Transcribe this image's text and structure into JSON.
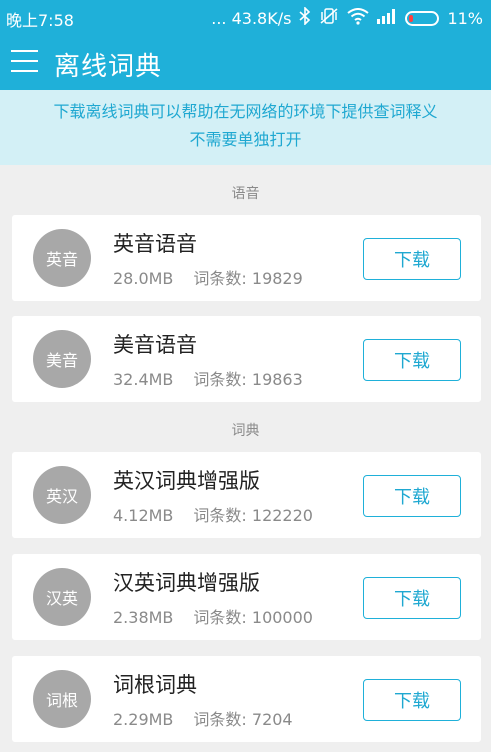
{
  "status": {
    "time": "晚上7:58",
    "network_speed": "... 43.8K/s",
    "battery_percent": "11%",
    "icons": [
      "bluetooth-icon",
      "vibrate-off-icon",
      "wifi-icon",
      "signal-icon",
      "battery-icon"
    ]
  },
  "appbar": {
    "title": "离线词典",
    "menu_icon": "menu-icon"
  },
  "notice": {
    "line1": "下载离线词典可以帮助在无网络的环境下提供查词释义",
    "line2": "不需要单独打开"
  },
  "sections": [
    {
      "label": "语音",
      "items": [
        {
          "badge": "英音",
          "name": "英音语音",
          "size": "28.0MB",
          "count": "词条数: 19829",
          "button": "下载"
        },
        {
          "badge": "美音",
          "name": "美音语音",
          "size": "32.4MB",
          "count": "词条数: 19863",
          "button": "下载"
        }
      ]
    },
    {
      "label": "词典",
      "items": [
        {
          "badge": "英汉",
          "name": "英汉词典增强版",
          "size": "4.12MB",
          "count": "词条数: 122220",
          "button": "下载"
        },
        {
          "badge": "汉英",
          "name": "汉英词典增强版",
          "size": "2.38MB",
          "count": "词条数: 100000",
          "button": "下载"
        },
        {
          "badge": "词根",
          "name": "词根词典",
          "size": "2.29MB",
          "count": "词条数: 7204",
          "button": "下载"
        }
      ]
    }
  ],
  "colors": {
    "accent": "#1fb0d9",
    "notice_bg": "#d3f0f6",
    "avatar_bg": "#a8a8a8",
    "page_bg": "#efefef"
  }
}
